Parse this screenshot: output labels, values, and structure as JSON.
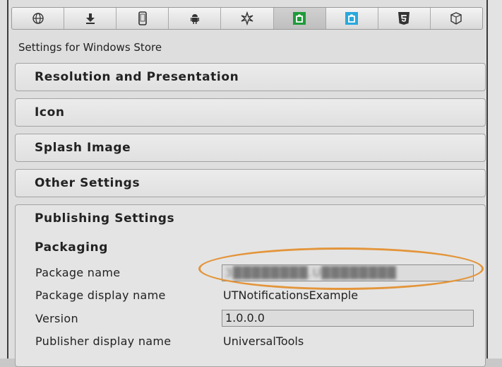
{
  "tabs": [
    {
      "icon": "globe-icon",
      "name": "tab-standalone",
      "active": false
    },
    {
      "icon": "download-icon",
      "name": "tab-webplayer",
      "active": false
    },
    {
      "icon": "phone-icon",
      "name": "tab-ios",
      "active": false
    },
    {
      "icon": "android-icon",
      "name": "tab-android",
      "active": false
    },
    {
      "icon": "blackberry-icon",
      "name": "tab-blackberry",
      "active": false
    },
    {
      "icon": "windows-store-green-icon",
      "name": "tab-windows-store",
      "active": true
    },
    {
      "icon": "windows-phone-icon",
      "name": "tab-windows-phone",
      "active": false
    },
    {
      "icon": "html5-icon",
      "name": "tab-webgl",
      "active": false
    },
    {
      "icon": "box-icon",
      "name": "tab-other",
      "active": false
    }
  ],
  "colors": {
    "accent_green": "#1f9b3a",
    "accent_blue": "#2aa8dc",
    "highlight_orange": "#e3953a"
  },
  "settings_title": "Settings for Windows Store",
  "foldouts": [
    "Resolution and Presentation",
    "Icon",
    "Splash Image",
    "Other Settings"
  ],
  "publishing": {
    "title": "Publishing Settings",
    "packaging_title": "Packaging",
    "rows": {
      "package_name_label": "Package name",
      "package_name_value": "3████████.U████████",
      "display_name_label": "Package display name",
      "display_name_value": "UTNotificationsExample",
      "version_label": "Version",
      "version_value": "1.0.0.0",
      "publisher_label": "Publisher display name",
      "publisher_value": "UniversalTools"
    }
  }
}
